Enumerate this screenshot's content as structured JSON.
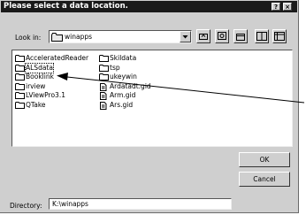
{
  "dialog": {
    "title": "Please select a data location.",
    "help_glyph": "?",
    "close_glyph": "×"
  },
  "lookin": {
    "label": "Look in:",
    "value": "winapps",
    "folder_icon": "folder-icon",
    "dropdown_icon": "chevron-down-icon"
  },
  "toolbar": {
    "buttons": [
      "up-folder-icon",
      "desktop-icon",
      "new-folder-icon",
      "list-view-icon",
      "details-view-icon"
    ]
  },
  "files": {
    "column1": [
      {
        "name": "AcceleratedReader",
        "icon": "folder-icon"
      },
      {
        "name": "ALSdata",
        "icon": "folder-icon",
        "selected": true
      },
      {
        "name": "Booklink",
        "icon": "folder-icon"
      },
      {
        "name": "irview",
        "icon": "folder-icon"
      },
      {
        "name": "LViewPro3.1",
        "icon": "folder-icon"
      },
      {
        "name": "QTake",
        "icon": "folder-icon"
      }
    ],
    "column2": [
      {
        "name": "Skildata",
        "icon": "folder-icon"
      },
      {
        "name": "tsp",
        "icon": "folder-icon"
      },
      {
        "name": "ukeywin",
        "icon": "folder-icon"
      },
      {
        "name": "Ardatadt.gid",
        "icon": "document-icon"
      },
      {
        "name": "Arm.gid",
        "icon": "document-icon"
      },
      {
        "name": "Ars.gid",
        "icon": "document-icon"
      }
    ]
  },
  "buttons": {
    "ok": "OK",
    "cancel": "Cancel"
  },
  "directory": {
    "label": "Directory:",
    "value": "K:\\winapps"
  }
}
